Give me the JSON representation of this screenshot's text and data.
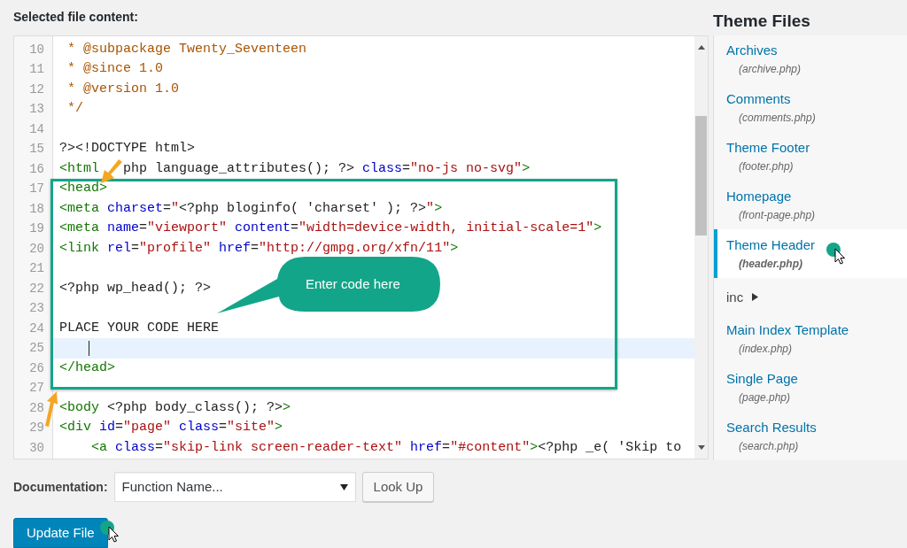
{
  "editor": {
    "title": "Selected file content:",
    "lines": [
      {
        "number": "10",
        "active": false,
        "segments": [
          {
            "text": " * @subpackage Twenty_Seventeen",
            "kind": "comment"
          }
        ]
      },
      {
        "number": "11",
        "active": false,
        "segments": [
          {
            "text": " * @since 1.0",
            "kind": "comment"
          }
        ]
      },
      {
        "number": "12",
        "active": false,
        "segments": [
          {
            "text": " * @version 1.0",
            "kind": "comment"
          }
        ]
      },
      {
        "number": "13",
        "active": false,
        "segments": [
          {
            "text": " */",
            "kind": "comment"
          }
        ]
      },
      {
        "number": "14",
        "active": false
      },
      {
        "number": "15",
        "active": false,
        "segments": [
          {
            "text": "?><!DOCTYPE html>",
            "kind": "plain"
          }
        ]
      },
      {
        "number": "16",
        "active": false,
        "segments": [
          {
            "text": "<html",
            "kind": "tag"
          },
          {
            "kind": "gap"
          },
          {
            "text": "php language_attributes(); ?> ",
            "kind": "plain"
          },
          {
            "text": "class",
            "kind": "attr"
          },
          {
            "text": "=",
            "kind": "plain"
          },
          {
            "text": "\"no-js no-svg\"",
            "kind": "string"
          },
          {
            "text": ">",
            "kind": "tag"
          }
        ]
      },
      {
        "number": "17",
        "active": false,
        "segments": [
          {
            "text": "<head>",
            "kind": "tag"
          }
        ]
      },
      {
        "number": "18",
        "active": false,
        "segments": [
          {
            "text": "<meta ",
            "kind": "tag"
          },
          {
            "text": "charset",
            "kind": "attr"
          },
          {
            "text": "=",
            "kind": "plain"
          },
          {
            "text": "\"",
            "kind": "string"
          },
          {
            "text": "<?php bloginfo( 'charset' ); ?>",
            "kind": "plain"
          },
          {
            "text": "\"",
            "kind": "string"
          },
          {
            "text": ">",
            "kind": "tag"
          }
        ]
      },
      {
        "number": "19",
        "active": false,
        "segments": [
          {
            "text": "<meta ",
            "kind": "tag"
          },
          {
            "text": "name",
            "kind": "attr"
          },
          {
            "text": "=",
            "kind": "plain"
          },
          {
            "text": "\"viewport\" ",
            "kind": "string"
          },
          {
            "text": "content",
            "kind": "attr"
          },
          {
            "text": "=",
            "kind": "plain"
          },
          {
            "text": "\"width=device-width, initial-scale=1\"",
            "kind": "string"
          },
          {
            "text": ">",
            "kind": "tag"
          }
        ]
      },
      {
        "number": "20",
        "active": false,
        "segments": [
          {
            "text": "<link ",
            "kind": "tag"
          },
          {
            "text": "rel",
            "kind": "attr"
          },
          {
            "text": "=",
            "kind": "plain"
          },
          {
            "text": "\"profile\" ",
            "kind": "string"
          },
          {
            "text": "href",
            "kind": "attr"
          },
          {
            "text": "=",
            "kind": "plain"
          },
          {
            "text": "\"http://gmpg.org/xfn/11\"",
            "kind": "string"
          },
          {
            "text": ">",
            "kind": "tag"
          }
        ]
      },
      {
        "number": "21",
        "active": false
      },
      {
        "number": "22",
        "active": false,
        "segments": [
          {
            "text": "<?php wp_head(); ?>",
            "kind": "plain"
          }
        ]
      },
      {
        "number": "23",
        "active": false
      },
      {
        "number": "24",
        "active": false,
        "segments": [
          {
            "text": "PLACE YOUR CODE HERE",
            "kind": "plain"
          }
        ]
      },
      {
        "number": "25",
        "active": true
      },
      {
        "number": "26",
        "active": false,
        "segments": [
          {
            "text": "</head>",
            "kind": "tag"
          }
        ]
      },
      {
        "number": "27",
        "active": false
      },
      {
        "number": "28",
        "active": false,
        "segments": [
          {
            "text": "<body",
            "kind": "tag"
          },
          {
            "text": " <?php body_class(); ?>",
            "kind": "plain"
          },
          {
            "text": ">",
            "kind": "tag"
          }
        ]
      },
      {
        "number": "29",
        "active": false,
        "segments": [
          {
            "text": "<div ",
            "kind": "tag"
          },
          {
            "text": "id",
            "kind": "attr"
          },
          {
            "text": "=",
            "kind": "plain"
          },
          {
            "text": "\"page\" ",
            "kind": "string"
          },
          {
            "text": "class",
            "kind": "attr"
          },
          {
            "text": "=",
            "kind": "plain"
          },
          {
            "text": "\"site\"",
            "kind": "string"
          },
          {
            "text": ">",
            "kind": "tag"
          }
        ]
      },
      {
        "number": "30",
        "active": false,
        "segments": [
          {
            "text": "    <a ",
            "kind": "tag"
          },
          {
            "text": "class",
            "kind": "attr"
          },
          {
            "text": "=",
            "kind": "plain"
          },
          {
            "text": "\"skip-link screen-reader-text\" ",
            "kind": "string"
          },
          {
            "text": "href",
            "kind": "attr"
          },
          {
            "text": "=",
            "kind": "plain"
          },
          {
            "text": "\"#content\"",
            "kind": "string"
          },
          {
            "text": ">",
            "kind": "tag"
          },
          {
            "text": "<?php _e( 'Skip to",
            "kind": "plain"
          }
        ]
      }
    ],
    "callout": "Enter code here"
  },
  "theme_files": {
    "title": "Theme Files",
    "items": [
      {
        "kind": "file",
        "name": "Archives",
        "file": "(archive.php)",
        "selected": false
      },
      {
        "kind": "file",
        "name": "Comments",
        "file": "(comments.php)",
        "selected": false
      },
      {
        "kind": "file",
        "name": "Theme Footer",
        "file": "(footer.php)",
        "selected": false
      },
      {
        "kind": "file",
        "name": "Homepage",
        "file": "(front-page.php)",
        "selected": false
      },
      {
        "kind": "file",
        "name": "Theme Header",
        "file": "(header.php)",
        "selected": true
      },
      {
        "kind": "folder",
        "name": "inc",
        "selected": false
      },
      {
        "kind": "file",
        "name": "Main Index Template",
        "file": "(index.php)",
        "selected": false
      },
      {
        "kind": "file",
        "name": "Single Page",
        "file": "(page.php)",
        "selected": false
      },
      {
        "kind": "file",
        "name": "Search Results",
        "file": "(search.php)",
        "selected": false
      }
    ]
  },
  "documentation": {
    "label": "Documentation:",
    "select": "Function Name...",
    "button": "Look Up"
  },
  "update_button": "Update File"
}
